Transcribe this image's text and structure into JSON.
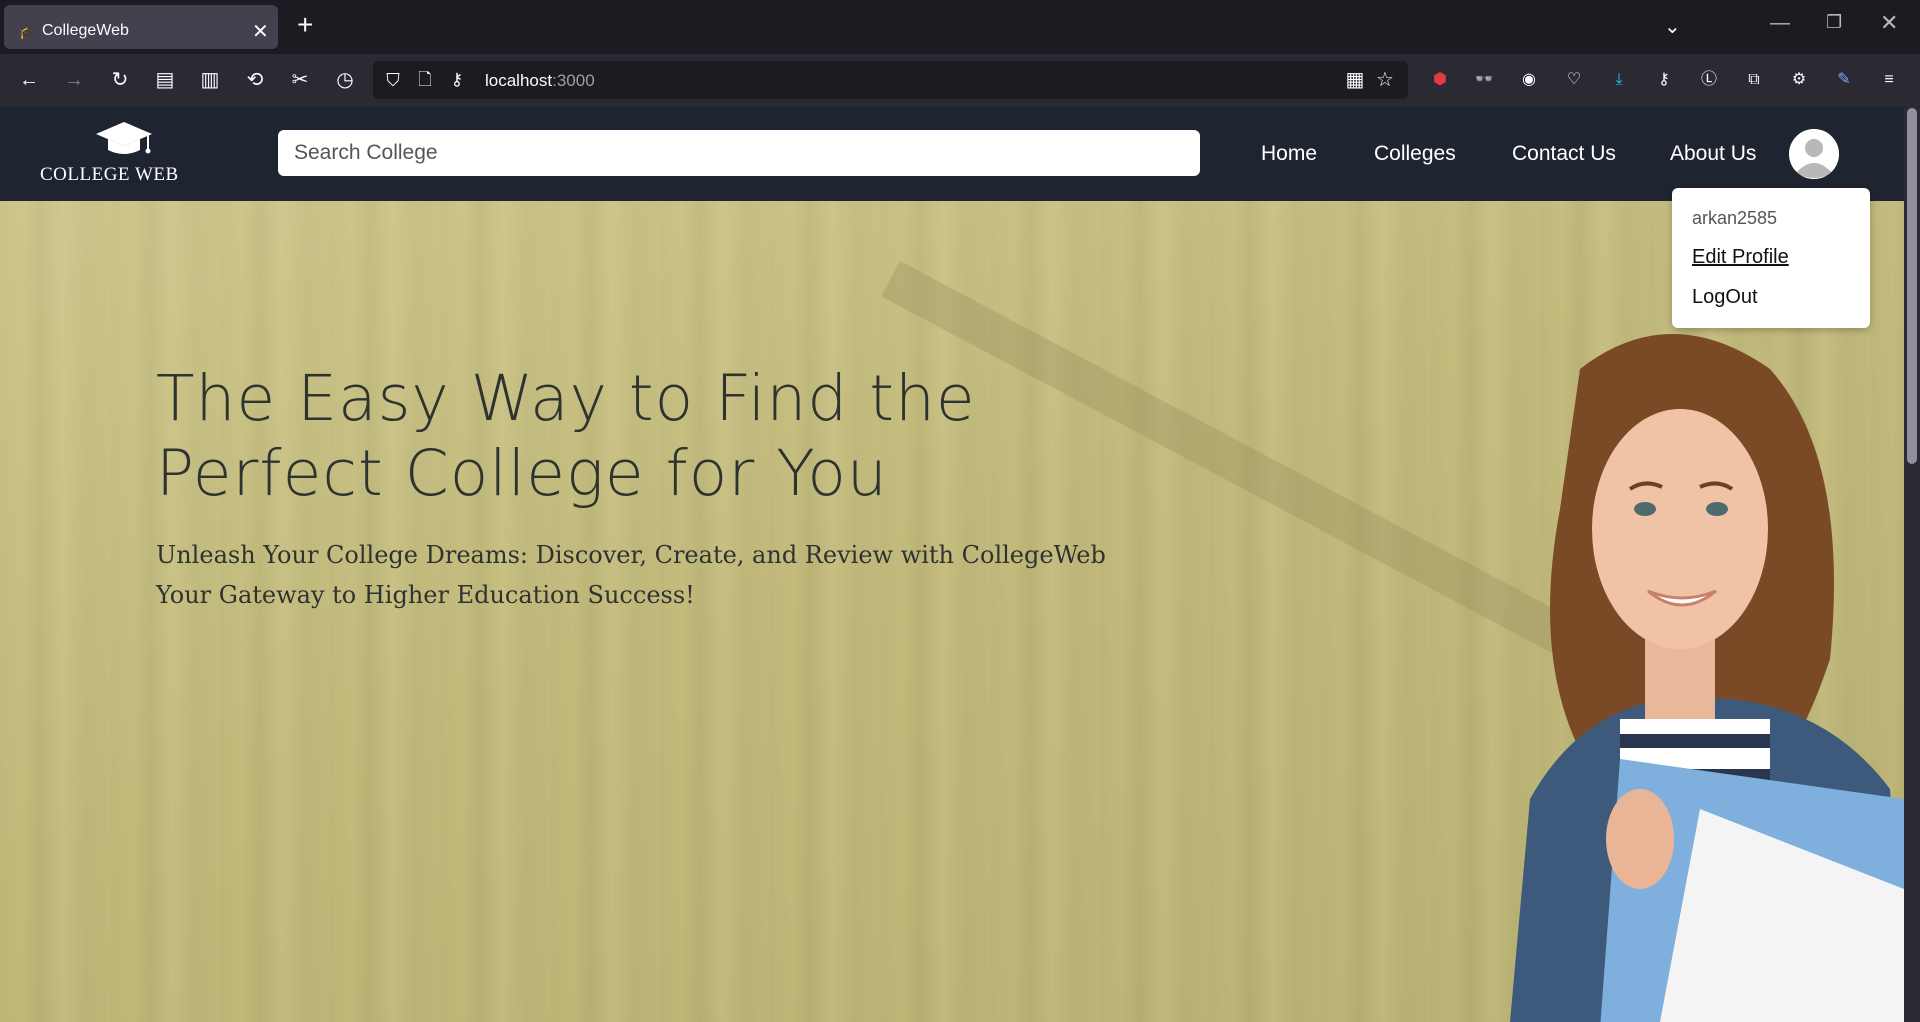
{
  "browser": {
    "tab_title": "CollegeWeb",
    "url_host": "localhost",
    "url_port": ":3000"
  },
  "site": {
    "logo_text": "COLLEGE WEB",
    "search_placeholder": "Search College",
    "menu": {
      "home": "Home",
      "colleges": "Colleges",
      "contact": "Contact Us",
      "about": "About Us"
    },
    "dropdown": {
      "username": "arkan2585",
      "edit_profile": "Edit Profile",
      "logout": "LogOut"
    }
  },
  "hero": {
    "title": "The Easy Way to Find the Perfect College for You",
    "subtitle_line1": "Unleash Your College Dreams: Discover, Create, and Review with CollegeWeb",
    "subtitle_line2": "Your Gateway to Higher Education Success!"
  },
  "icons": [
    "graduation-cap-icon",
    "close-icon",
    "plus-icon",
    "chevron-down-icon",
    "back-icon",
    "forward-icon",
    "reload-icon",
    "shield-icon",
    "page-icon",
    "key-icon",
    "star-icon",
    "gear-icon",
    "menu-icon"
  ]
}
